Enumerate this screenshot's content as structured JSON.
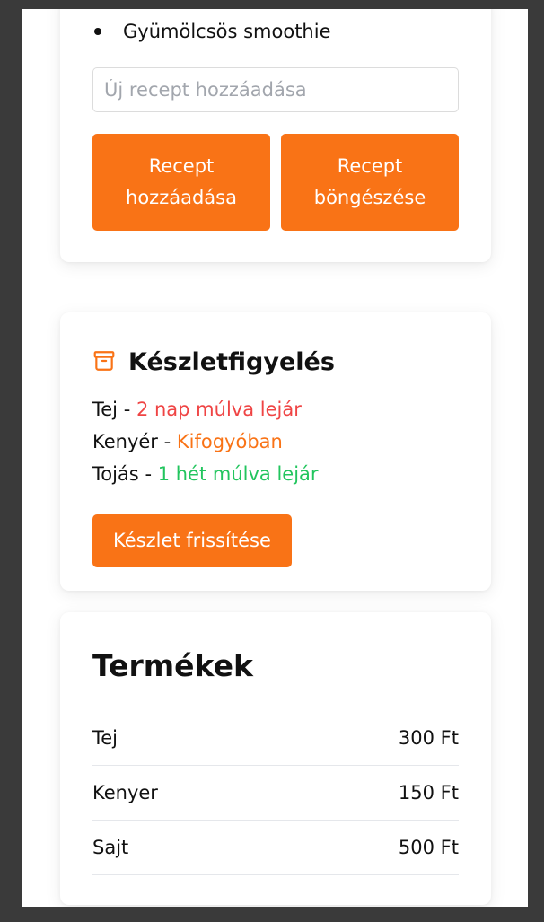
{
  "recipes": {
    "items": [
      "Gyümölcsös smoothie"
    ],
    "input_placeholder": "Új recept hozzáadása",
    "add_button": "Recept hozzáadása",
    "browse_button": "Recept böngészése"
  },
  "inventory": {
    "title": "Készletfigyelés",
    "icon": "archive-box-icon",
    "items": [
      {
        "name": "Tej",
        "separator": " - ",
        "status": "2 nap múlva lejár",
        "status_color": "#ef4444"
      },
      {
        "name": "Kenyér",
        "separator": " - ",
        "status": "Kifogyóban",
        "status_color": "#f97316"
      },
      {
        "name": "Tojás",
        "separator": " - ",
        "status": "1 hét múlva lejár",
        "status_color": "#22c55e"
      }
    ],
    "update_button": "Készlet frissítése"
  },
  "products": {
    "title": "Termékek",
    "rows": [
      {
        "name": "Tej",
        "price": "300 Ft"
      },
      {
        "name": "Kenyer",
        "price": "150 Ft"
      },
      {
        "name": "Sajt",
        "price": "500 Ft"
      }
    ]
  },
  "colors": {
    "accent": "#f97316",
    "page_background": "#3a3a3a",
    "card_background": "#ffffff"
  }
}
